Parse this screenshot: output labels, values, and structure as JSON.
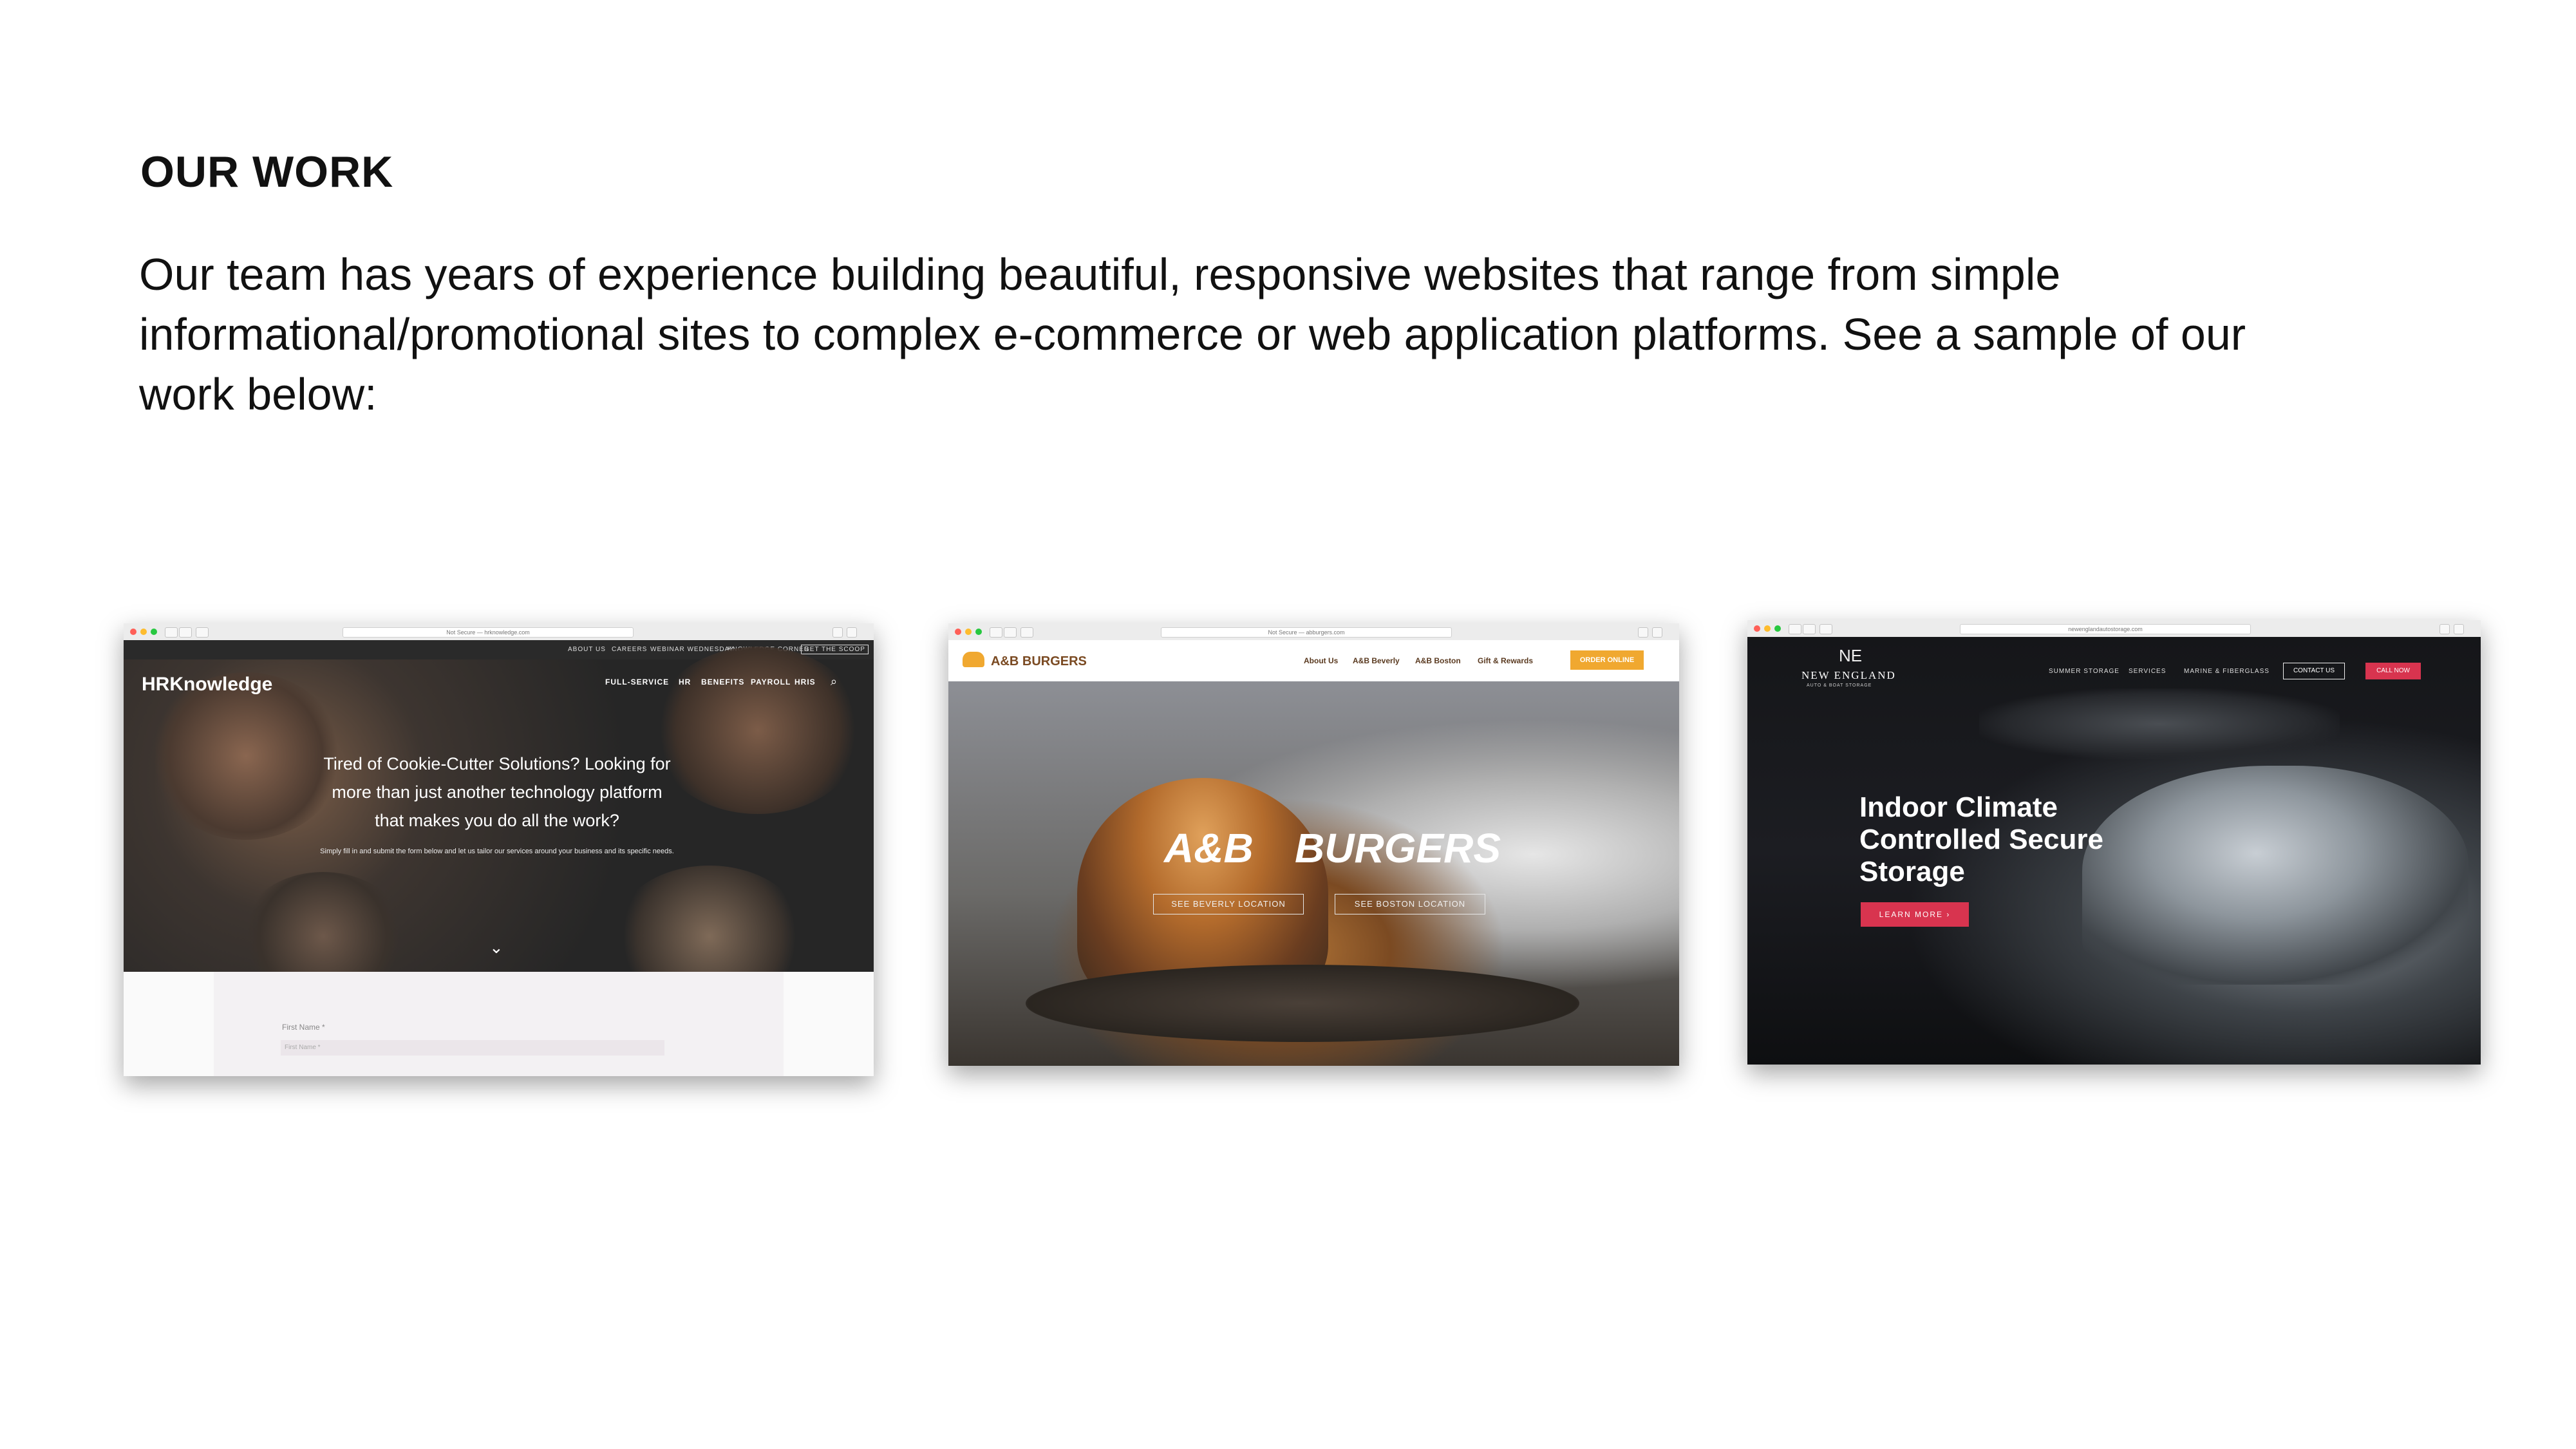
{
  "heading": "OUR WORK",
  "intro": "Our team has years of experience building beautiful, responsive websites that range from simple informational/promotional sites to complex e-commerce or web application platforms. See a sample of our work below:",
  "colors": {
    "burger_accent": "#f0a830",
    "red_button": "#d8344f"
  },
  "shots": [
    {
      "url": "Not Secure — hrknowledge.com",
      "logo": "HRKnowledge",
      "topnav": [
        "ABOUT US",
        "CAREERS",
        "WEBINAR WEDNESDAY",
        "KNOWLEDGE CORNER",
        "GET THE SCOOP"
      ],
      "nav": [
        "FULL-SERVICE",
        "HR",
        "BENEFITS",
        "PAYROLL",
        "HRIS"
      ],
      "headline": "Tired of Cookie-Cutter Solutions? Looking for more than just another technology platform that makes you do all the work?",
      "subtext": "Simply fill in and submit the form below and let us tailor our services around your business and its specific needs.",
      "form_label": "First Name *",
      "form_placeholder": "First Name *"
    },
    {
      "url": "Not Secure — abburgers.com",
      "brand": "A&B BURGERS",
      "nav": [
        "About Us",
        "A&B Beverly",
        "A&B Boston",
        "Gift & Rewards"
      ],
      "cta": "ORDER ONLINE",
      "hero_title_left": "A&B",
      "hero_title_right": "BURGERS",
      "buttons": [
        "SEE BEVERLY LOCATION",
        "SEE BOSTON LOCATION"
      ]
    },
    {
      "url": "newenglandautostorage.com",
      "logo_mark": "NE",
      "logo": "NEW ENGLAND",
      "logo_sub": "AUTO & BOAT STORAGE",
      "nav": [
        "SUMMER STORAGE",
        "SERVICES",
        "MARINE & FIBERGLASS"
      ],
      "contact": "CONTACT US",
      "call": "CALL NOW",
      "headline": "Indoor Climate Controlled Secure Storage",
      "button": "LEARN MORE ›"
    }
  ]
}
